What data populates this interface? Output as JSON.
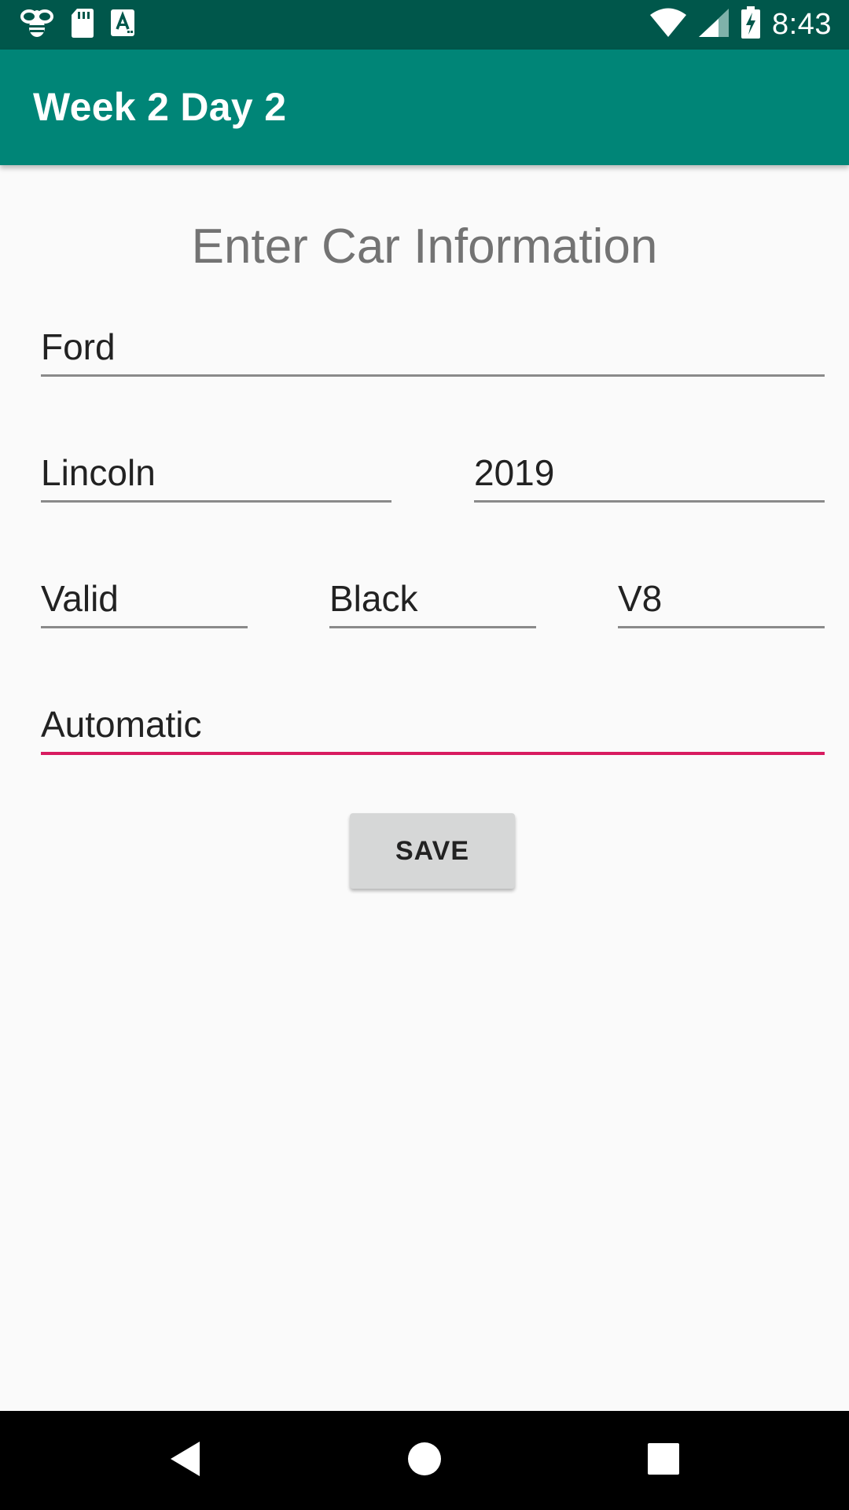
{
  "status_bar": {
    "time": "8:43",
    "left_icons": [
      "bee-icon",
      "sd-card-icon",
      "text-a-icon"
    ],
    "right_icons": [
      "wifi-icon",
      "signal-icon",
      "battery-charging-icon"
    ]
  },
  "app_bar": {
    "title": "Week 2 Day 2"
  },
  "form": {
    "heading": "Enter Car Information",
    "make": "Ford",
    "model": "Lincoln",
    "year": "2019",
    "status": "Valid",
    "color": "Black",
    "engine": "V8",
    "transmission": "Automatic",
    "save_label": "SAVE"
  },
  "nav_bar": {
    "icons": [
      "back-icon",
      "home-icon",
      "recents-icon"
    ]
  },
  "colors": {
    "status_bar": "#00574b",
    "app_bar": "#008577",
    "accent": "#d81b60",
    "background": "#fafafa"
  }
}
